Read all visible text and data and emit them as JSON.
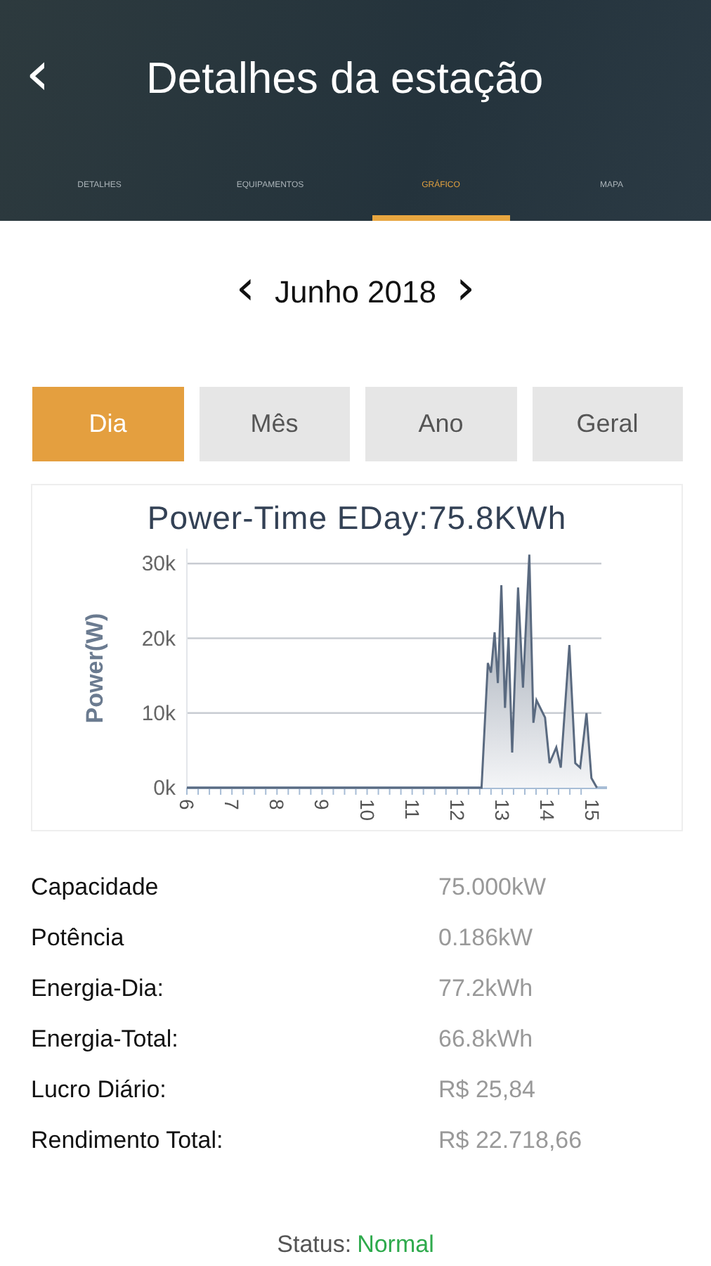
{
  "header": {
    "title": "Detalhes da estação",
    "back": "‹"
  },
  "tabs": [
    {
      "label": "DETALHES",
      "selected": false
    },
    {
      "label": "EQUIPAMENTOS",
      "selected": false
    },
    {
      "label": "GRÁFICO",
      "selected": true
    },
    {
      "label": "MAPA",
      "selected": false
    }
  ],
  "period": {
    "prev": "‹",
    "label": "Junho 2018",
    "next": "›"
  },
  "ranges": [
    {
      "label": "Dia",
      "selected": true
    },
    {
      "label": "Mês",
      "selected": false
    },
    {
      "label": "Ano",
      "selected": false
    },
    {
      "label": "Geral",
      "selected": false
    }
  ],
  "chart": {
    "chart_data": {
      "type": "area",
      "title": "Power-Time EDay:75.8KWh",
      "ylabel": "Power(W)",
      "x": [
        6,
        12.5,
        12.54,
        12.68,
        12.75,
        12.83,
        12.9,
        12.98,
        13.06,
        13.14,
        13.22,
        13.35,
        13.46,
        13.6,
        13.69,
        13.76,
        13.95,
        14.05,
        14.2,
        14.3,
        14.49,
        14.62,
        14.73,
        14.87,
        14.98,
        15.1
      ],
      "series": [
        {
          "color": "#5a6a80",
          "values": [
            0,
            0,
            0,
            16700,
            15400,
            20800,
            14000,
            27100,
            10700,
            20100,
            4700,
            26800,
            13400,
            31200,
            8700,
            11700,
            9400,
            3300,
            5400,
            2700,
            19100,
            3300,
            2700,
            10000,
            1300,
            0
          ]
        }
      ],
      "xlim": [
        6,
        15.2
      ],
      "ylim": [
        0,
        32000
      ],
      "grid": true,
      "xticks": [
        6,
        7,
        8,
        9,
        10,
        11,
        12,
        13,
        14,
        15
      ],
      "yticks": [
        {
          "value": 0,
          "label": "0k"
        },
        {
          "value": 10000,
          "label": "10k"
        },
        {
          "value": 20000,
          "label": "20k"
        },
        {
          "value": 30000,
          "label": "30k"
        }
      ]
    }
  },
  "details": [
    {
      "label": "Capacidade",
      "value": "75.000kW"
    },
    {
      "label": "Potência",
      "value": "0.186kW"
    },
    {
      "label": "Energia-Dia:",
      "value": "77.2kWh"
    },
    {
      "label": "Energia-Total:",
      "value": "66.8kWh"
    },
    {
      "label": "Lucro Diário:",
      "value": "R$ 25,84"
    },
    {
      "label": "Rendimento Total:",
      "value": "R$ 22.718,66"
    }
  ],
  "status": {
    "label": "Status:",
    "value": "Normal"
  }
}
